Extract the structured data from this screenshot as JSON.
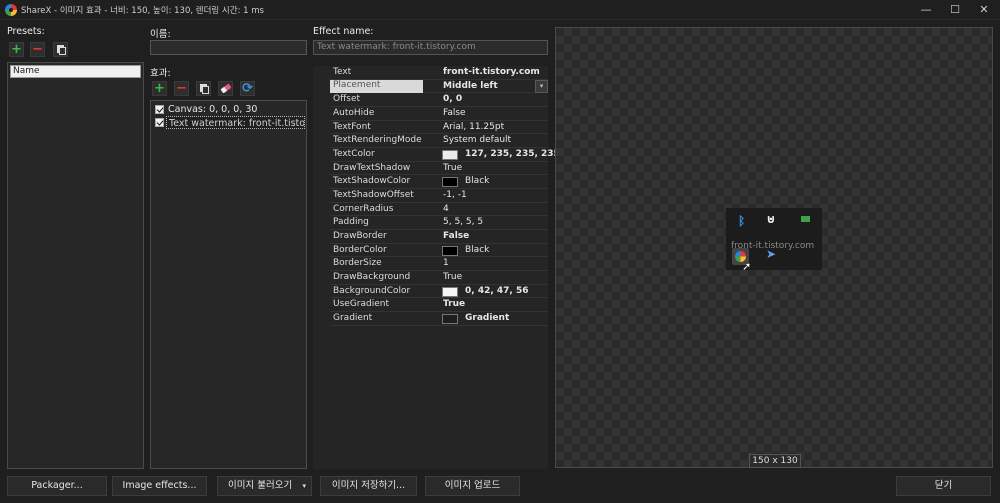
{
  "window": {
    "title": "ShareX - 이미지 효과 - 너비: 150, 높이: 130, 렌더링 시간: 1 ms",
    "minimize": "—",
    "maximize": "☐",
    "close": "✕"
  },
  "presets": {
    "label": "Presets:",
    "items": [
      "Name"
    ]
  },
  "name_field": {
    "label": "이름:",
    "value": ""
  },
  "effects": {
    "label": "효과:",
    "items": [
      {
        "text": "Canvas: 0, 0, 0, 30",
        "checked": true,
        "selected": false
      },
      {
        "text": "Text watermark: front-it.tistor...",
        "checked": true,
        "selected": true
      }
    ]
  },
  "effect_name": {
    "label": "Effect name:",
    "placeholder": "Text watermark: front-it.tistory.com"
  },
  "properties": [
    {
      "name": "Text",
      "value": "front-it.tistory.com",
      "bold": true
    },
    {
      "name": "Placement",
      "value": "Middle left",
      "bold": true,
      "selected": true,
      "dropdown": true
    },
    {
      "name": "Offset",
      "value": "0, 0",
      "bold": true
    },
    {
      "name": "AutoHide",
      "value": "False"
    },
    {
      "name": "TextFont",
      "value": "Arial, 11.25pt"
    },
    {
      "name": "TextRenderingMode",
      "value": "System default"
    },
    {
      "name": "TextColor",
      "value": "127, 235, 235, 235",
      "bold": true,
      "swatch": "#ebebeb"
    },
    {
      "name": "DrawTextShadow",
      "value": "True"
    },
    {
      "name": "TextShadowColor",
      "value": "Black",
      "swatch": "#000000"
    },
    {
      "name": "TextShadowOffset",
      "value": "-1, -1"
    },
    {
      "name": "CornerRadius",
      "value": "4"
    },
    {
      "name": "Padding",
      "value": "5, 5, 5, 5"
    },
    {
      "name": "DrawBorder",
      "value": "False",
      "bold": true
    },
    {
      "name": "BorderColor",
      "value": "Black",
      "swatch": "#000000"
    },
    {
      "name": "BorderSize",
      "value": "1"
    },
    {
      "name": "DrawBackground",
      "value": "True"
    },
    {
      "name": "BackgroundColor",
      "value": "0, 42, 47, 56",
      "bold": true,
      "swatch": "#f5f5f5"
    },
    {
      "name": "UseGradient",
      "value": "True",
      "bold": true
    },
    {
      "name": "Gradient",
      "value": "Gradient",
      "bold": true,
      "swatch": "#1e1e1e"
    }
  ],
  "preview": {
    "watermark_text": "front-it.tistory.com",
    "dimensions": "150 x 130"
  },
  "buttons": {
    "packager": "Packager...",
    "image_effects": "Image effects...",
    "load_image": "이미지 불러오기",
    "save_image": "이미지 저장하기...",
    "upload_image": "이미지 업로드",
    "close": "닫기"
  }
}
